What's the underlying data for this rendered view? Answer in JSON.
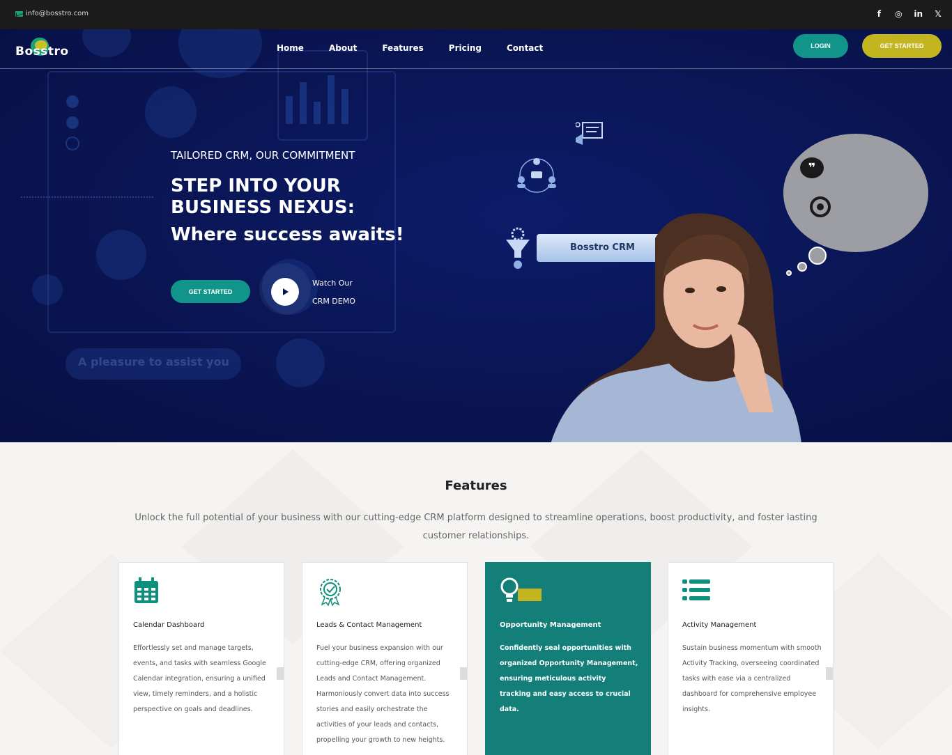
{
  "topbar": {
    "email": "info@bosstro.com",
    "social": [
      {
        "name": "facebook-icon",
        "glyph": "f"
      },
      {
        "name": "instagram-icon",
        "glyph": "◎"
      },
      {
        "name": "linkedin-icon",
        "glyph": "in"
      },
      {
        "name": "x-icon",
        "glyph": "𝕏"
      }
    ]
  },
  "nav": {
    "logo": "Bosstro",
    "links": [
      "Home",
      "About",
      "Features",
      "Pricing",
      "Contact"
    ],
    "login": "LOGIN",
    "get_started": "GET STARTED"
  },
  "hero": {
    "background_text": "A pleasure to assist you",
    "tagline": "TAILORED CRM, OUR COMMITMENT",
    "headline": "STEP INTO YOUR BUSINESS NEXUS:",
    "subheadline": "Where success awaits!",
    "cta": "GET STARTED",
    "watch_line1": "Watch Our",
    "watch_line2": "CRM DEMO",
    "crm_label": "Bosstro CRM"
  },
  "features": {
    "title": "Features",
    "description": "Unlock the full potential of your business with our cutting-edge CRM platform designed to streamline operations, boost productivity, and foster lasting customer relationships.",
    "cards": [
      {
        "title": "Calendar Dashboard",
        "body": "Effortlessly set and manage targets, events, and tasks with seamless Google Calendar integration, ensuring a unified view, timely reminders, and a holistic perspective on goals and deadlines."
      },
      {
        "title": "Leads & Contact Management",
        "body": "Fuel your business expansion with our cutting-edge CRM, offering organized Leads and Contact Management. Harmoniously convert data into success stories and easily orchestrate the activities of your leads and contacts, propelling your growth to new heights."
      },
      {
        "title": "Opportunity Management",
        "body": "Confidently seal opportunities with organized Opportunity Management, ensuring meticulous activity tracking and easy access to crucial data."
      },
      {
        "title": "Activity Management",
        "body": "Sustain business momentum with smooth Activity Tracking, overseeing coordinated tasks with ease via a centralized dashboard for comprehensive employee insights."
      }
    ]
  },
  "colors": {
    "teal": "#11958a",
    "olive": "#c2b51f",
    "hero_bg": "#0a1656",
    "active_card": "#137f78"
  }
}
